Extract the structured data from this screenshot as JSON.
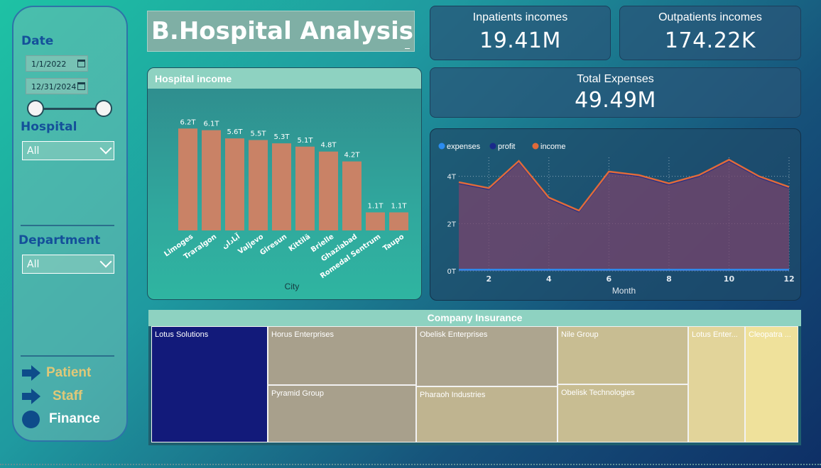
{
  "title": "B.Hospital Analysis",
  "filters": {
    "date_label": "Date",
    "date_start": "1/1/2022",
    "date_end": "12/31/2024",
    "hospital_label": "Hospital",
    "hospital_value": "All",
    "department_label": "Department",
    "department_value": "All"
  },
  "nav": [
    {
      "label": "Patient",
      "icon": "arrow-right-icon",
      "color": "#e0c878"
    },
    {
      "label": "Staff",
      "icon": "arrow-right-icon",
      "color": "#e0c878"
    },
    {
      "label": "Finance",
      "icon": "circle-icon",
      "color": "#ffffff"
    }
  ],
  "kpis": {
    "inpatients_label": "Inpatients incomes",
    "inpatients_value": "19.41M",
    "outpatients_label": "Outpatients incomes",
    "outpatients_value": "174.22K",
    "expenses_label": "Total Expenses",
    "expenses_value": "49.49M"
  },
  "bar_chart_title": "Hospital income",
  "line_chart_data_note": "",
  "chart_data": [
    {
      "type": "bar",
      "categories": [
        "Limoges",
        "Traralgon",
        "آبادان",
        "Valjevo",
        "Giresun",
        "Kittilä",
        "Brielle",
        "Ghaziabad",
        "Romedal Sentrum",
        "Taupo"
      ],
      "values": [
        6.2,
        6.1,
        5.6,
        5.5,
        5.3,
        5.1,
        4.8,
        4.2,
        1.1,
        1.1
      ],
      "data_labels": [
        "6.2T",
        "6.1T",
        "5.6T",
        "5.5T",
        "5.3T",
        "5.1T",
        "4.8T",
        "4.2T",
        "1.1T",
        "1.1T"
      ],
      "title": "Hospital income",
      "xlabel": "City",
      "ylabel": "",
      "ylim": [
        0,
        6.6
      ],
      "color": "#c98266"
    },
    {
      "type": "area",
      "x": [
        1,
        2,
        3,
        4,
        5,
        6,
        7,
        8,
        9,
        10,
        11,
        12
      ],
      "series": [
        {
          "name": "expenses",
          "color": "#2b8cf0",
          "values": [
            0.05,
            0.05,
            0.05,
            0.05,
            0.05,
            0.05,
            0.05,
            0.05,
            0.05,
            0.05,
            0.05,
            0.05
          ]
        },
        {
          "name": "profit",
          "color": "#1a2a8a",
          "values": [
            3.7,
            3.45,
            4.6,
            3.05,
            2.5,
            4.15,
            4.0,
            3.65,
            4.0,
            4.65,
            3.95,
            3.5
          ]
        },
        {
          "name": "income",
          "color": "#e06a3a",
          "values": [
            3.75,
            3.5,
            4.65,
            3.1,
            2.55,
            4.2,
            4.05,
            3.7,
            4.05,
            4.7,
            4.0,
            3.55
          ]
        }
      ],
      "xticks": [
        "2",
        "4",
        "6",
        "8",
        "10",
        "12"
      ],
      "xtick_values": [
        2,
        4,
        6,
        8,
        10,
        12
      ],
      "yticks": [
        "0T",
        "2T",
        "4T"
      ],
      "ytick_values": [
        0,
        2,
        4
      ],
      "xlabel": "Month",
      "ylabel": "",
      "ylim": [
        0,
        4.8
      ],
      "legend": "top-left"
    }
  ],
  "treemap": {
    "title": "Company Insurance",
    "tiles": [
      {
        "label": "Lotus Solutions",
        "color": "#121a7a"
      },
      {
        "label": "Horus Enterprises",
        "color": "#a8a08c"
      },
      {
        "label": "Pyramid Group",
        "color": "#a8a08c"
      },
      {
        "label": "Obelisk Enterprises",
        "color": "#ada58f"
      },
      {
        "label": "Pharaoh Industries",
        "color": "#bfb490"
      },
      {
        "label": "Nile Group",
        "color": "#c8bd92"
      },
      {
        "label": "Obelisk Technologies",
        "color": "#c8bd92"
      },
      {
        "label": "Lotus Enter...",
        "color": "#e2d49a"
      },
      {
        "label": "Cleopatra ...",
        "color": "#efe19b"
      }
    ]
  }
}
